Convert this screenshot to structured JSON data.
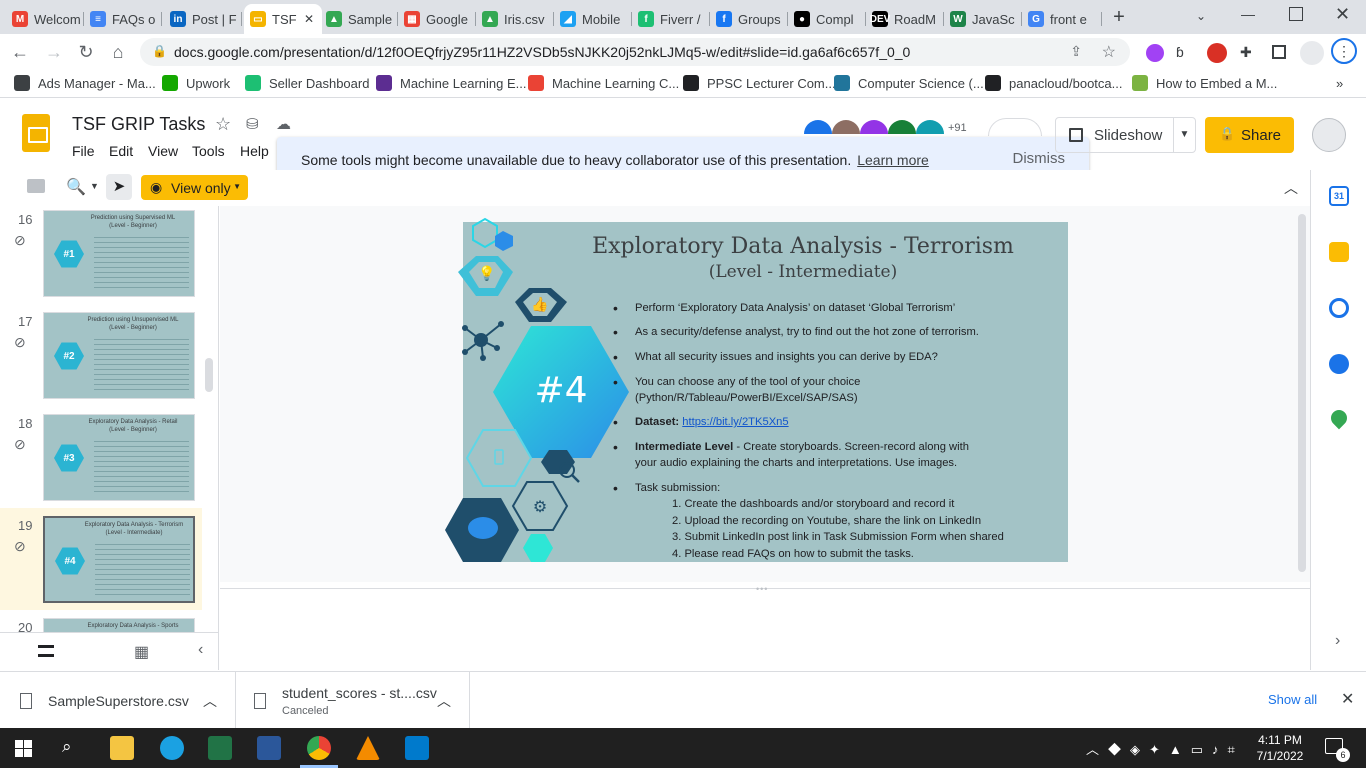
{
  "browser": {
    "tabs": [
      {
        "label": "Welcom",
        "fav_color": "#ea4335",
        "glyph": "M"
      },
      {
        "label": "FAQs o",
        "fav_color": "#4285f4",
        "glyph": "≡"
      },
      {
        "label": "Post | F",
        "fav_color": "#0a66c2",
        "glyph": "in"
      },
      {
        "label": "TSF",
        "fav_color": "#f4b400",
        "glyph": "▭",
        "active": true
      },
      {
        "label": "Sample",
        "fav_color": "#34a853",
        "glyph": "▲"
      },
      {
        "label": "Google",
        "fav_color": "#ea4335",
        "glyph": "▦"
      },
      {
        "label": "Iris.csv",
        "fav_color": "#34a853",
        "glyph": "▲"
      },
      {
        "label": "Mobile",
        "fav_color": "#1da1f2",
        "glyph": "◢"
      },
      {
        "label": "Fiverr /",
        "fav_color": "#1dbf73",
        "glyph": "f"
      },
      {
        "label": "Groups",
        "fav_color": "#1877f2",
        "glyph": "f"
      },
      {
        "label": "Compl",
        "fav_color": "#000000",
        "glyph": "●"
      },
      {
        "label": "RoadM",
        "fav_color": "#000000",
        "glyph": "DEV"
      },
      {
        "label": "JavaSc",
        "fav_color": "#1e8449",
        "glyph": "W"
      },
      {
        "label": "front e",
        "fav_color": "#4285f4",
        "glyph": "G"
      }
    ],
    "new_tab": "+",
    "url": "docs.google.com/presentation/d/12f0OEQfrjyZ95r11HZ2VSDb5sNJKK20j52nkLJMq5-w/edit#slide=id.ga6af6c657f_0_0",
    "bookmarks": [
      {
        "label": "Ads Manager - Ma...",
        "color": "#3c4043"
      },
      {
        "label": "Upwork",
        "color": "#14a800"
      },
      {
        "label": "Seller Dashboard",
        "color": "#1dbf73"
      },
      {
        "label": "Machine Learning E...",
        "color": "#5c2d91"
      },
      {
        "label": "Machine Learning C...",
        "color": "#ea4335"
      },
      {
        "label": "PPSC Lecturer Com...",
        "color": "#202124"
      },
      {
        "label": "Computer Science (...",
        "color": "#21759b"
      },
      {
        "label": "panacloud/bootca...",
        "color": "#202124"
      },
      {
        "label": "How to Embed a M...",
        "color": "#7cb342"
      }
    ]
  },
  "doc": {
    "title": "TSF GRIP Tasks",
    "menus": [
      "File",
      "Edit",
      "View",
      "Tools",
      "Help"
    ],
    "banner_text": "Some tools might become unavailable due to heavy collaborator use of this presentation.",
    "banner_link": "Learn more",
    "banner_dismiss": "Dismiss",
    "collab_count": "+91",
    "slideshow_label": "Slideshow",
    "share_label": "Share",
    "view_only_label": "View only"
  },
  "filmstrip": [
    {
      "num": "16",
      "title": "Prediction using Supervised ML",
      "level": "(Level - Beginner)",
      "badge": "#1"
    },
    {
      "num": "17",
      "title": "Prediction using Unsupervised ML",
      "level": "(Level - Beginner)",
      "badge": "#2"
    },
    {
      "num": "18",
      "title": "Exploratory Data Analysis - Retail",
      "level": "(Level - Beginner)",
      "badge": "#3"
    },
    {
      "num": "19",
      "title": "Exploratory Data Analysis - Terrorism",
      "level": "(Level - Intermediate)",
      "badge": "#4"
    },
    {
      "num": "20",
      "title": "Exploratory Data Analysis - Sports",
      "level": "",
      "badge": ""
    }
  ],
  "slide": {
    "title": "Exploratory Data Analysis - Terrorism",
    "subtitle": "(Level - Intermediate)",
    "badge": "#4",
    "bullets": [
      "Perform ‘Exploratory Data Analysis’ on dataset  ‘Global Terrorism’",
      "As a security/defense analyst, try to find out the hot zone of terrorism.",
      "What all security issues and insights you can derive by EDA?",
      "You can choose any of the tool of your choice",
      "(Python/R/Tableau/PowerBI/Excel/SAP/SAS)"
    ],
    "dataset_label": "Dataset:",
    "dataset_link": "https://bit.ly/2TK5Xn5",
    "level_label": "Intermediate Level",
    "level_text_1": " - Create storyboards. Screen-record along with",
    "level_text_2": "your audio explaining the charts and interpretations. Use images.",
    "task_heading": "Task submission:",
    "tasks": [
      "1. Create the dashboards and/or storyboard and record it",
      "2. Upload the recording on Youtube, share the link on LinkedIn",
      "3. Submit LinkedIn post link in Task Submission Form when shared",
      "4. Please read FAQs on how to submit the tasks."
    ],
    "bg_color": "#a3c3c6",
    "hex_color": "#2bb4d2",
    "dark_hex_color": "#1f4e6b"
  },
  "downloads": [
    {
      "name": "SampleSuperstore.csv",
      "status": ""
    },
    {
      "name": "student_scores - st....csv",
      "status": "Canceled"
    }
  ],
  "downloads_show_all": "Show all",
  "taskbar": {
    "time": "4:11 PM",
    "date": "7/1/2022",
    "notif": "6"
  }
}
